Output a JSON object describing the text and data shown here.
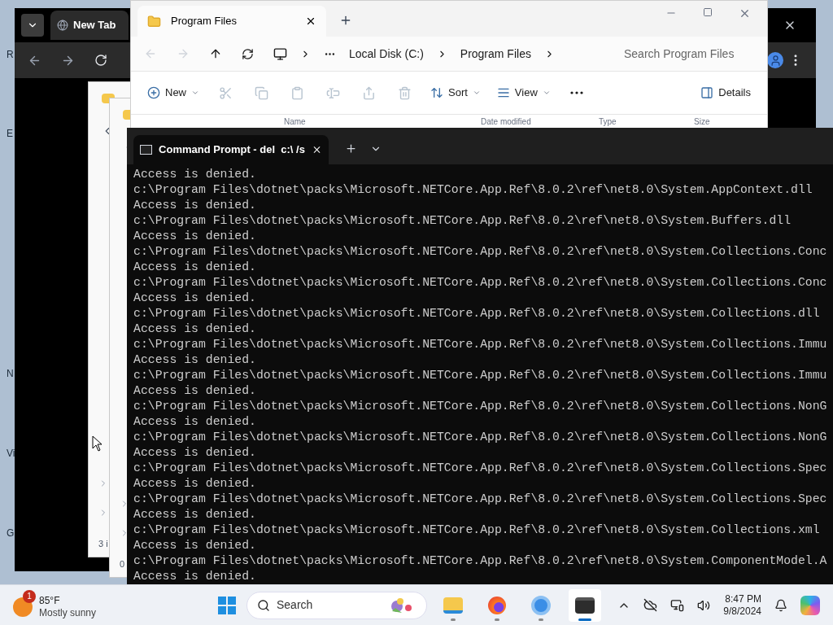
{
  "desktop_labels": [
    "R",
    "E",
    "N",
    "Vi",
    "G"
  ],
  "browser": {
    "tab": "New Tab"
  },
  "back_windows": [
    {
      "status": "3 i"
    },
    {
      "status": "0"
    }
  ],
  "explorer": {
    "tab": "Program Files",
    "breadcrumb": [
      "Local Disk (C:)",
      "Program Files"
    ],
    "search": {
      "placeholder": "Search Program Files"
    },
    "toolbar": [
      {
        "kind": "menu",
        "label": "New",
        "disabled": false
      },
      {
        "kind": "action",
        "disabled": true
      },
      {
        "kind": "action",
        "disabled": true
      },
      {
        "kind": "action",
        "disabled": true
      },
      {
        "kind": "action",
        "disabled": true
      },
      {
        "kind": "action",
        "disabled": true
      },
      {
        "kind": "action",
        "disabled": true
      },
      {
        "kind": "menu",
        "label": "Sort",
        "disabled": false
      },
      {
        "kind": "menu",
        "label": "View",
        "disabled": false
      },
      {
        "kind": "more",
        "disabled": false
      },
      {
        "kind": "pane",
        "label": "Details",
        "disabled": false
      }
    ],
    "columns": [
      "Name",
      "Date modified",
      "Type",
      "Size"
    ]
  },
  "terminal": {
    "tab": "Command Prompt - del  c:\\ /s",
    "lines": [
      "Access is denied.",
      "c:\\Program Files\\dotnet\\packs\\Microsoft.NETCore.App.Ref\\8.0.2\\ref\\net8.0\\System.AppContext.dll",
      "Access is denied.",
      "c:\\Program Files\\dotnet\\packs\\Microsoft.NETCore.App.Ref\\8.0.2\\ref\\net8.0\\System.Buffers.dll",
      "Access is denied.",
      "c:\\Program Files\\dotnet\\packs\\Microsoft.NETCore.App.Ref\\8.0.2\\ref\\net8.0\\System.Collections.Conc",
      "Access is denied.",
      "c:\\Program Files\\dotnet\\packs\\Microsoft.NETCore.App.Ref\\8.0.2\\ref\\net8.0\\System.Collections.Conc",
      "Access is denied.",
      "c:\\Program Files\\dotnet\\packs\\Microsoft.NETCore.App.Ref\\8.0.2\\ref\\net8.0\\System.Collections.dll",
      "Access is denied.",
      "c:\\Program Files\\dotnet\\packs\\Microsoft.NETCore.App.Ref\\8.0.2\\ref\\net8.0\\System.Collections.Immu",
      "Access is denied.",
      "c:\\Program Files\\dotnet\\packs\\Microsoft.NETCore.App.Ref\\8.0.2\\ref\\net8.0\\System.Collections.Immu",
      "Access is denied.",
      "c:\\Program Files\\dotnet\\packs\\Microsoft.NETCore.App.Ref\\8.0.2\\ref\\net8.0\\System.Collections.NonG",
      "Access is denied.",
      "c:\\Program Files\\dotnet\\packs\\Microsoft.NETCore.App.Ref\\8.0.2\\ref\\net8.0\\System.Collections.NonG",
      "Access is denied.",
      "c:\\Program Files\\dotnet\\packs\\Microsoft.NETCore.App.Ref\\8.0.2\\ref\\net8.0\\System.Collections.Spec",
      "Access is denied.",
      "c:\\Program Files\\dotnet\\packs\\Microsoft.NETCore.App.Ref\\8.0.2\\ref\\net8.0\\System.Collections.Spec",
      "Access is denied.",
      "c:\\Program Files\\dotnet\\packs\\Microsoft.NETCore.App.Ref\\8.0.2\\ref\\net8.0\\System.Collections.xml",
      "Access is denied.",
      "c:\\Program Files\\dotnet\\packs\\Microsoft.NETCore.App.Ref\\8.0.2\\ref\\net8.0\\System.ComponentModel.A",
      "Access is denied."
    ]
  },
  "taskbar": {
    "weather": {
      "badge": "1",
      "temperature": "85°F",
      "condition": "Mostly sunny"
    },
    "search": {
      "placeholder": "Search"
    },
    "apps": [
      {
        "selected": false
      },
      {
        "selected": false
      },
      {
        "selected": false
      },
      {
        "selected": true
      }
    ],
    "time": "8:47 PM",
    "date": "9/8/2024"
  }
}
